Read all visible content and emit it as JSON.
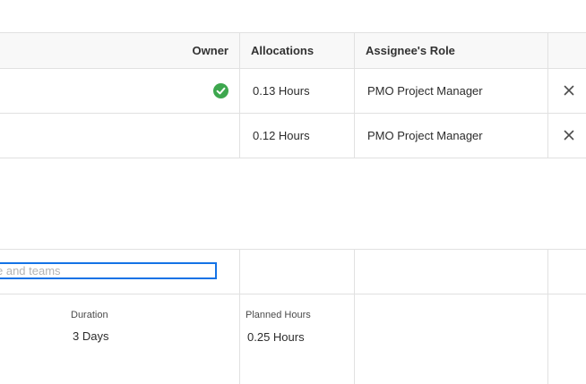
{
  "table": {
    "headers": {
      "owner": "Owner",
      "allocations": "Allocations",
      "role": "Assignee's Role"
    },
    "rows": [
      {
        "owner_check": true,
        "allocation": "0.13 Hours",
        "role": "PMO Project Manager"
      },
      {
        "owner_check": false,
        "allocation": "0.12 Hours",
        "role": "PMO Project Manager"
      }
    ]
  },
  "assign": {
    "placeholder": "e and teams"
  },
  "summary": {
    "duration_label": "Duration",
    "duration_value": "3 Days",
    "planned_label": "Planned Hours",
    "planned_value": "0.25 Hours"
  },
  "icons": {
    "owner": "checkmark-circle-icon",
    "remove": "close-icon"
  },
  "colors": {
    "accent": "#1473e6",
    "success": "#3da74e"
  }
}
